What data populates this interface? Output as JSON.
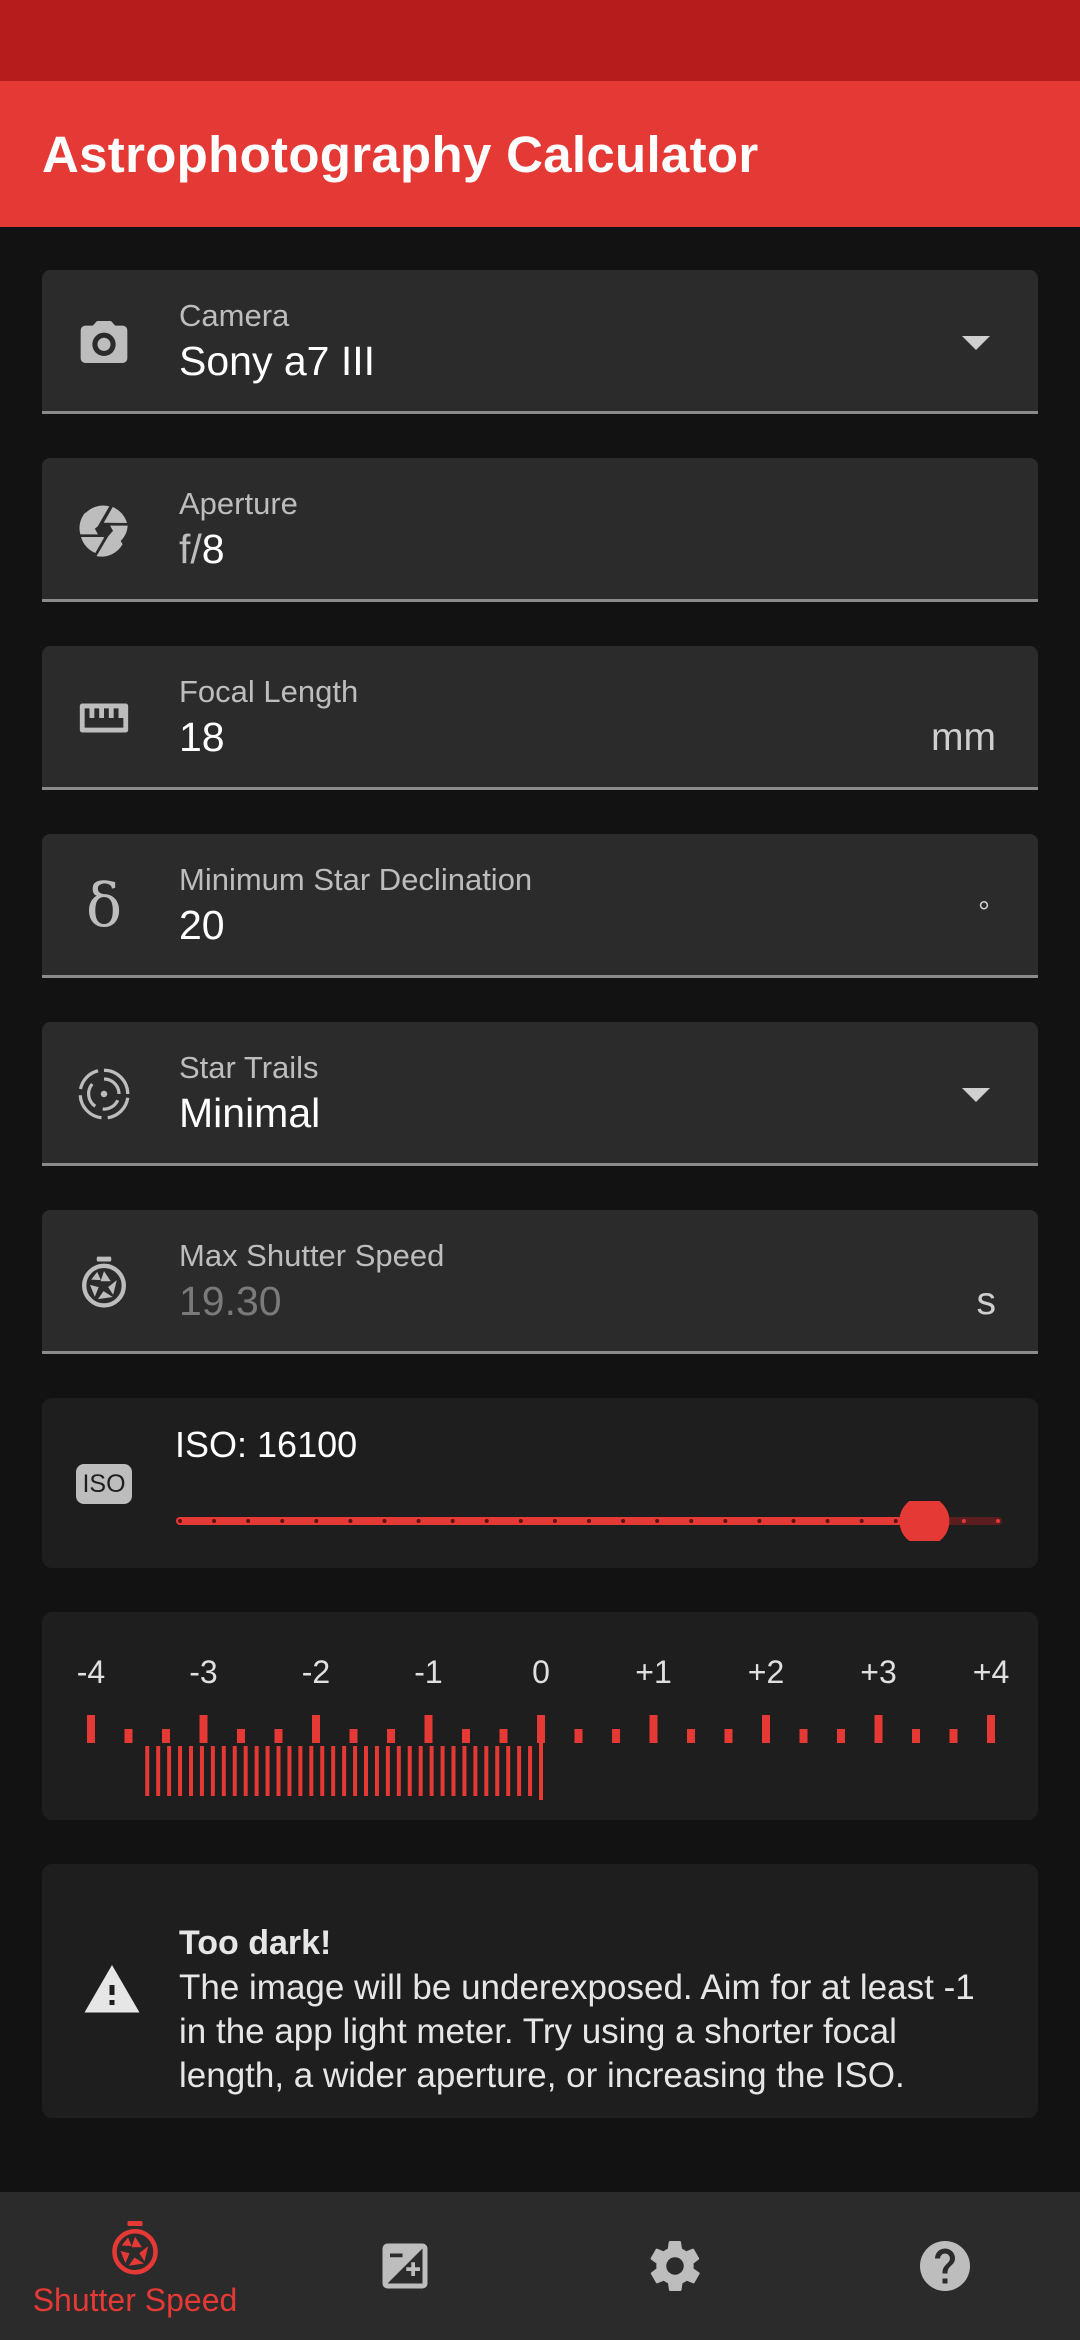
{
  "app": {
    "title": "Astrophotography Calculator"
  },
  "fields": {
    "camera": {
      "label": "Camera",
      "value": "Sony a7 III"
    },
    "aperture": {
      "label": "Aperture",
      "prefix": "f/",
      "value": "8"
    },
    "focal_length": {
      "label": "Focal Length",
      "value": "18",
      "suffix": "mm"
    },
    "declination": {
      "label": "Minimum Star Declination",
      "value": "20",
      "suffix": "°"
    },
    "star_trails": {
      "label": "Star Trails",
      "value": "Minimal"
    },
    "max_shutter": {
      "label": "Max Shutter Speed",
      "value": "19.30",
      "suffix": "s"
    }
  },
  "iso": {
    "badge": "ISO",
    "label": "ISO: 16100",
    "slider_fraction": 0.91,
    "dots": 25
  },
  "meter": {
    "labels": [
      "-4",
      "-3",
      "-2",
      "-1",
      "0",
      "+1",
      "+2",
      "+3",
      "+4"
    ],
    "reading_start": -3.5,
    "reading_end": 0,
    "color": "#e53935"
  },
  "warning": {
    "title": "Too dark!",
    "body": "The image will be underexposed. Aim for at least -1 in the app light meter. Try using a shorter focal length, a wider aperture, or increasing the ISO."
  },
  "nav": {
    "items": [
      {
        "label": "Shutter Speed",
        "icon": "stopwatch-icon",
        "active": true
      },
      {
        "label": "",
        "icon": "exposure-icon",
        "active": false
      },
      {
        "label": "",
        "icon": "gear-icon",
        "active": false
      },
      {
        "label": "",
        "icon": "help-icon",
        "active": false
      }
    ]
  },
  "colors": {
    "accent": "#e53935",
    "status_bar": "#b71c1c",
    "background": "#121212"
  }
}
